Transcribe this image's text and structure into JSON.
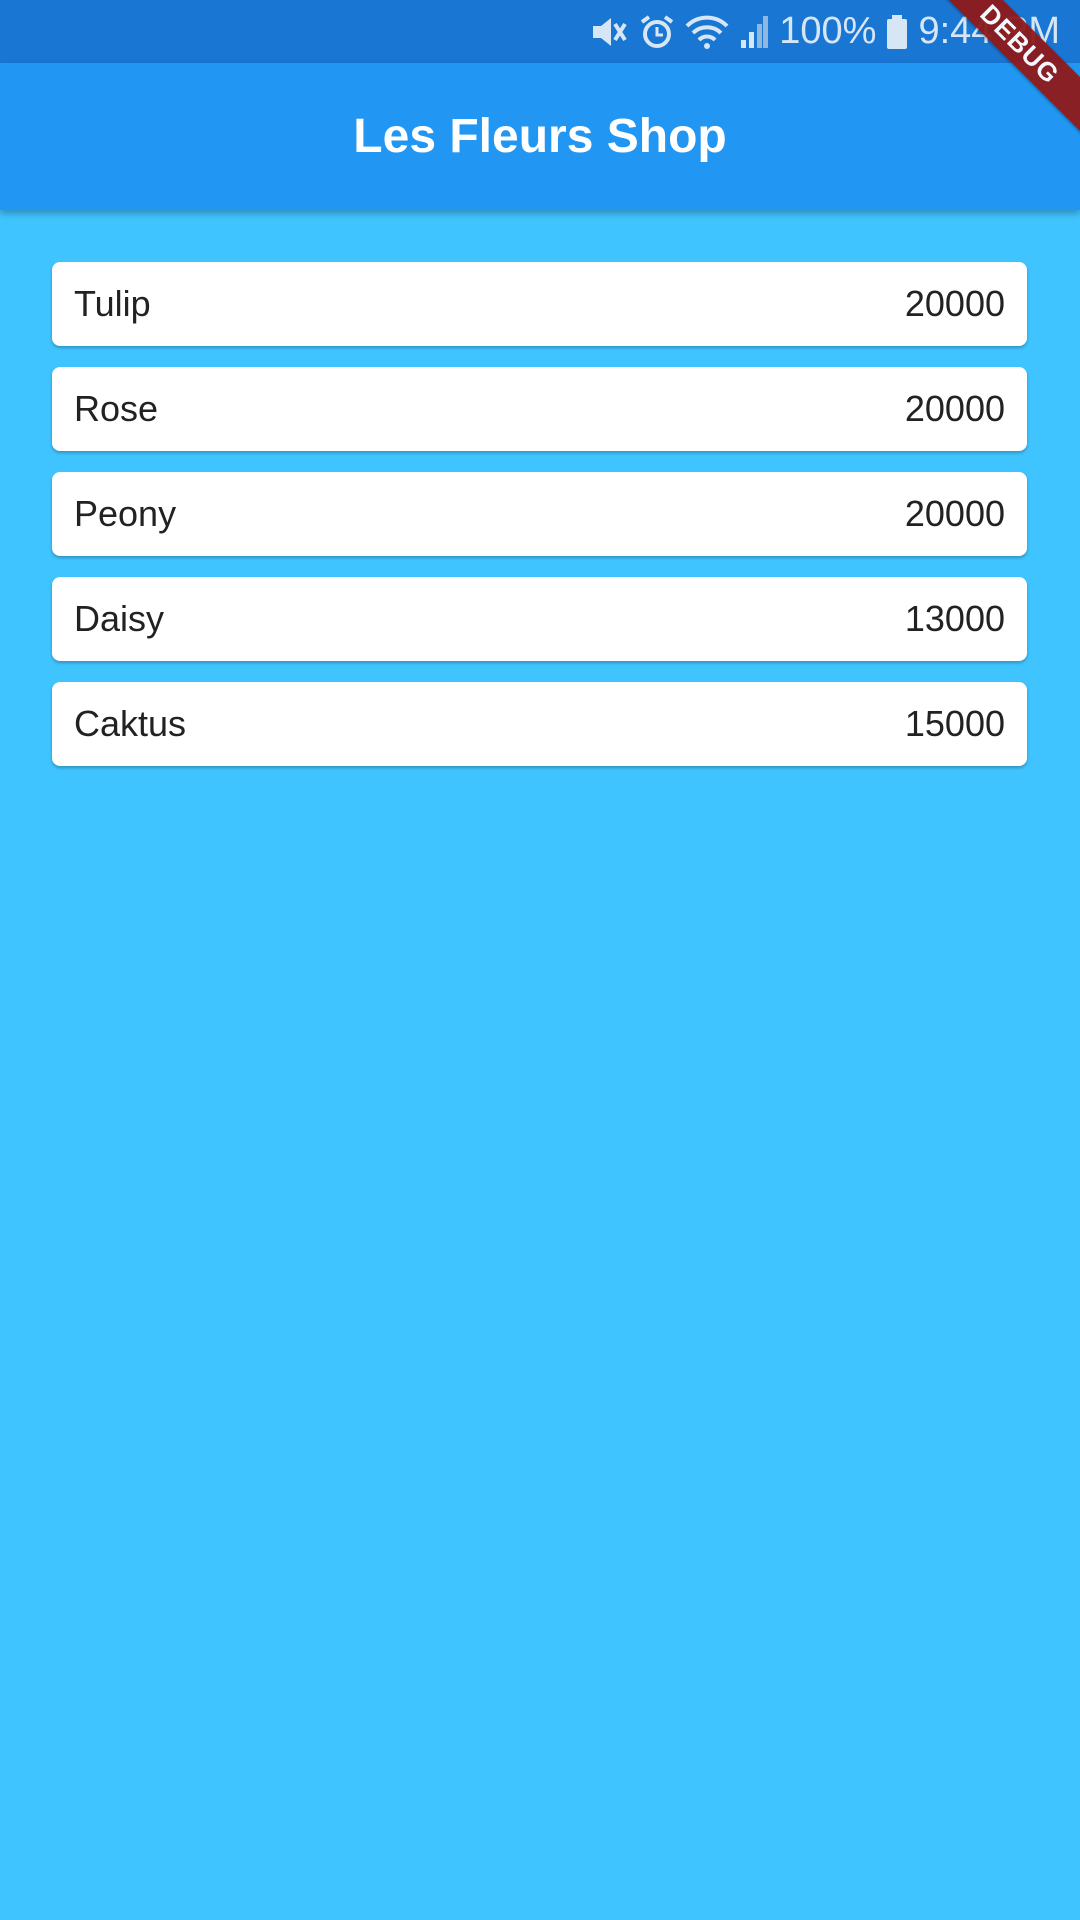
{
  "status_bar": {
    "battery_percent": "100%",
    "time": "9:44 PM",
    "icons": [
      "mute-icon",
      "alarm-icon",
      "wifi-icon",
      "signal-icon",
      "battery-icon"
    ],
    "background_color": "#1976D2"
  },
  "app_bar": {
    "title": "Les Fleurs Shop",
    "background_color": "#2196F3"
  },
  "debug_banner": {
    "label": "DEBUG",
    "color": "#8E1A1A"
  },
  "flowers": [
    {
      "name": "Tulip",
      "price": "20000"
    },
    {
      "name": "Rose",
      "price": "20000"
    },
    {
      "name": "Peony",
      "price": "20000"
    },
    {
      "name": "Daisy",
      "price": "13000"
    },
    {
      "name": "Caktus",
      "price": "15000"
    }
  ],
  "page": {
    "background_color": "#40C4FF"
  }
}
